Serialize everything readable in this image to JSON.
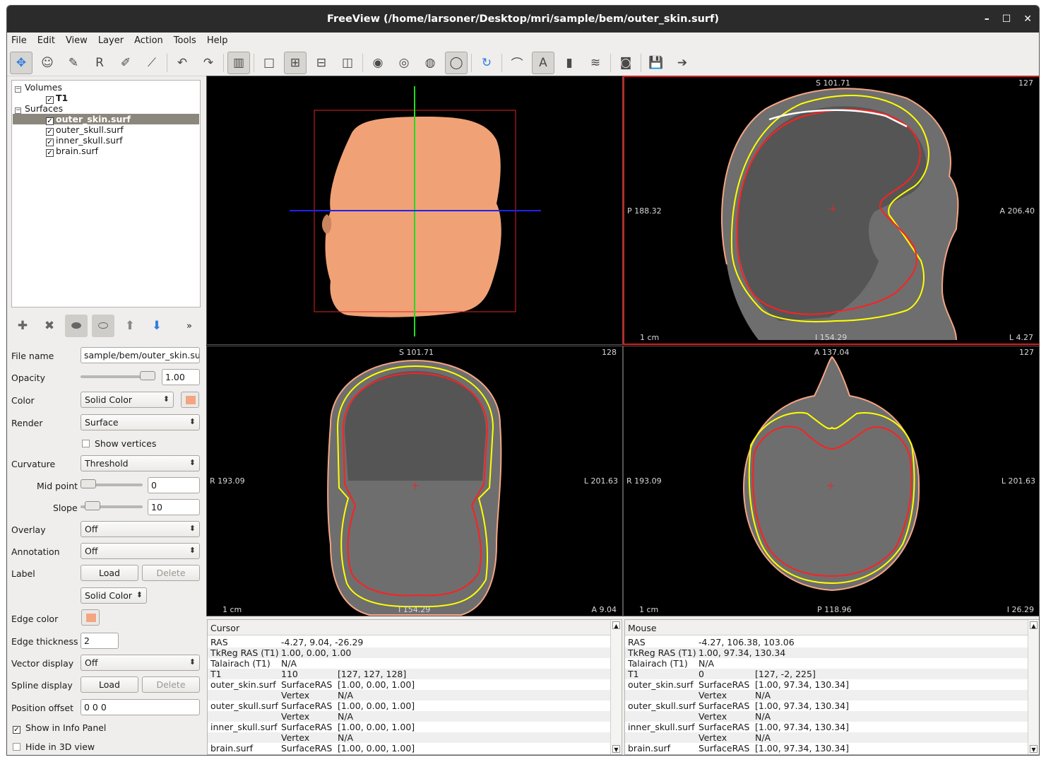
{
  "window": {
    "title": "FreeView (/home/larsoner/Desktop/mri/sample/bem/outer_skin.surf)",
    "minimize": "–",
    "maximize": "☐",
    "close": "✕"
  },
  "menu": [
    "File",
    "Edit",
    "View",
    "Layer",
    "Action",
    "Tools",
    "Help"
  ],
  "toolbar": {
    "icons": [
      "navigate-icon",
      "recon-edit-icon",
      "voxel-edit-icon",
      "roi-edit-icon",
      "point-set-edit-icon",
      "contour-icon",
      "undo-icon",
      "redo-icon",
      "toggle-panel-icon",
      "layout-1x1-icon",
      "layout-2x2-icon",
      "layout-1-3-icon",
      "layout-1-3h-icon",
      "sagittal-view-icon",
      "coronal-view-icon",
      "axial-view-icon",
      "3d-view-icon",
      "reset-view-icon",
      "show-surface-icon",
      "show-annotation-icon",
      "colorbar-icon",
      "histogram-icon",
      "snapshot-icon",
      "save-point-icon",
      "goto-point-icon"
    ],
    "glyphs": [
      "✥",
      "☺",
      "✎",
      "R",
      "✐",
      "⟋",
      "↶",
      "↷",
      "▥",
      "□",
      "⊞",
      "⊟",
      "◫",
      "◉",
      "◎",
      "◍",
      "◯",
      "↻",
      "⌒",
      "A",
      "▮",
      "≋",
      "◙",
      "💾",
      "➔"
    ]
  },
  "layers": {
    "volumes_label": "Volumes",
    "volumes": [
      "T1"
    ],
    "surfaces_label": "Surfaces",
    "surfaces": [
      "outer_skin.surf",
      "outer_skull.surf",
      "inner_skull.surf",
      "brain.surf"
    ],
    "selected": "outer_skin.surf"
  },
  "layer_tools": {
    "more": "»"
  },
  "props": {
    "file_name_label": "File name",
    "file_name": "sample/bem/outer_skin.surf",
    "opacity_label": "Opacity",
    "opacity": "1.00",
    "opacity_level": 1.0,
    "color_label": "Color",
    "color_mode": "Solid Color",
    "color": "#f4a582",
    "render_label": "Render",
    "render": "Surface",
    "show_vertices": "Show vertices",
    "curvature_label": "Curvature",
    "curvature": "Threshold",
    "midpoint_label": "Mid point",
    "midpoint": "0",
    "slope_label": "Slope",
    "slope": "10",
    "overlay_label": "Overlay",
    "overlay": "Off",
    "annotation_label": "Annotation",
    "annotation": "Off",
    "label_label": "Label",
    "load": "Load",
    "delete": "Delete",
    "label_color": "Solid Color",
    "edge_color_label": "Edge color",
    "edge_thickness_label": "Edge thickness",
    "edge_thickness": "2",
    "vector_display_label": "Vector display",
    "vector_display": "Off",
    "spline_display_label": "Spline display",
    "position_offset_label": "Position offset",
    "position_offset": "0 0 0",
    "show_in_info": "Show in Info Panel",
    "hide_in_3d": "Hide in 3D view"
  },
  "views": {
    "sagittal": {
      "top": "S 101.71",
      "slice": "127",
      "left": "P 188.32",
      "right": "A 206.40",
      "bottom": "I 154.29",
      "corner": "L 4.27",
      "scale": "1 cm"
    },
    "coronal": {
      "top": "S 101.71",
      "slice": "128",
      "left": "R 193.09",
      "right": "L 201.63",
      "bottom": "I 154.29",
      "corner": "A 9.04",
      "scale": "1 cm"
    },
    "axial": {
      "top": "A 137.04",
      "slice": "127",
      "left": "R 193.09",
      "right": "L 201.63",
      "bottom": "P 118.96",
      "corner": "I 26.29",
      "scale": "1 cm"
    }
  },
  "colors": {
    "skin": "#f4a582",
    "skull": "#ffff00",
    "inner": "#ff2020",
    "brain": "#ffffff",
    "active_border": "#e01a1a"
  },
  "cursor_panel": {
    "header": "Cursor",
    "rows": [
      [
        "RAS",
        "-4.27, 9.04, -26.29",
        ""
      ],
      [
        "TkReg RAS (T1)",
        "1.00, 0.00, 1.00",
        ""
      ],
      [
        "Talairach (T1)",
        "N/A",
        ""
      ],
      [
        "T1",
        "110",
        "[127, 127, 128]"
      ],
      [
        "outer_skin.surf",
        "SurfaceRAS",
        "[1.00, 0.00, 1.00]"
      ],
      [
        "",
        "Vertex",
        "N/A"
      ],
      [
        "outer_skull.surf",
        "SurfaceRAS",
        "[1.00, 0.00, 1.00]"
      ],
      [
        "",
        "Vertex",
        "N/A"
      ],
      [
        "inner_skull.surf",
        "SurfaceRAS",
        "[1.00, 0.00, 1.00]"
      ],
      [
        "",
        "Vertex",
        "N/A"
      ],
      [
        "brain.surf",
        "SurfaceRAS",
        "[1.00, 0.00, 1.00]"
      ]
    ]
  },
  "mouse_panel": {
    "header": "Mouse",
    "rows": [
      [
        "RAS",
        "-4.27, 106.38, 103.06",
        ""
      ],
      [
        "TkReg RAS (T1)",
        "1.00, 97.34, 130.34",
        ""
      ],
      [
        "Talairach (T1)",
        "N/A",
        ""
      ],
      [
        "T1",
        "0",
        "[127, -2, 225]"
      ],
      [
        "outer_skin.surf",
        "SurfaceRAS",
        "[1.00, 97.34, 130.34]"
      ],
      [
        "",
        "Vertex",
        "N/A"
      ],
      [
        "outer_skull.surf",
        "SurfaceRAS",
        "[1.00, 97.34, 130.34]"
      ],
      [
        "",
        "Vertex",
        "N/A"
      ],
      [
        "inner_skull.surf",
        "SurfaceRAS",
        "[1.00, 97.34, 130.34]"
      ],
      [
        "",
        "Vertex",
        "N/A"
      ],
      [
        "brain.surf",
        "SurfaceRAS",
        "[1.00, 97.34, 130.34]"
      ]
    ]
  }
}
